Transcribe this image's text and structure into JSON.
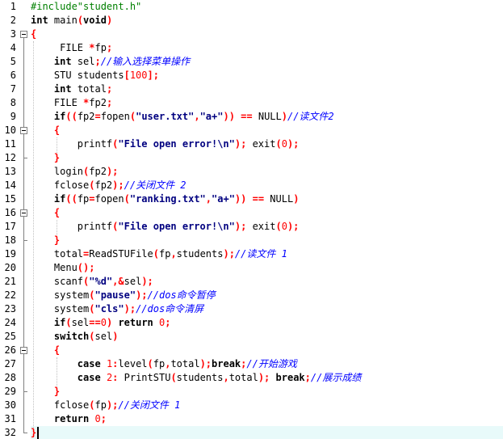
{
  "editor": {
    "current_line": 32,
    "lines": [
      {
        "n": "1",
        "tokens": [
          [
            "pp",
            "#include\"student.h\""
          ]
        ]
      },
      {
        "n": "2",
        "tokens": [
          [
            "kw",
            "int"
          ],
          [
            "pl",
            " main"
          ],
          [
            "op",
            "("
          ],
          [
            "kw",
            "void"
          ],
          [
            "op",
            ")"
          ]
        ]
      },
      {
        "n": "3",
        "tokens": [
          [
            "op",
            "{"
          ]
        ]
      },
      {
        "n": "4",
        "tokens": [
          [
            "pl",
            "     FILE "
          ],
          [
            "op",
            "*"
          ],
          [
            "pl",
            "fp"
          ],
          [
            "op",
            ";"
          ]
        ]
      },
      {
        "n": "5",
        "tokens": [
          [
            "pl",
            "    "
          ],
          [
            "kw",
            "int"
          ],
          [
            "pl",
            " sel"
          ],
          [
            "op",
            ";"
          ],
          [
            "cm",
            "//输入选择菜单操作"
          ]
        ]
      },
      {
        "n": "6",
        "tokens": [
          [
            "pl",
            "    STU students"
          ],
          [
            "op",
            "["
          ],
          [
            "num",
            "100"
          ],
          [
            "op",
            "];"
          ]
        ]
      },
      {
        "n": "7",
        "tokens": [
          [
            "pl",
            "    "
          ],
          [
            "kw",
            "int"
          ],
          [
            "pl",
            " total"
          ],
          [
            "op",
            ";"
          ]
        ]
      },
      {
        "n": "8",
        "tokens": [
          [
            "pl",
            "    FILE "
          ],
          [
            "op",
            "*"
          ],
          [
            "pl",
            "fp2"
          ],
          [
            "op",
            ";"
          ]
        ]
      },
      {
        "n": "9",
        "tokens": [
          [
            "pl",
            "    "
          ],
          [
            "kw",
            "if"
          ],
          [
            "op",
            "(("
          ],
          [
            "pl",
            "fp2"
          ],
          [
            "op",
            "="
          ],
          [
            "pl",
            "fopen"
          ],
          [
            "op",
            "("
          ],
          [
            "str",
            "\"user.txt\""
          ],
          [
            "op",
            ","
          ],
          [
            "str",
            "\"a+\""
          ],
          [
            "op",
            "))"
          ],
          [
            "pl",
            " "
          ],
          [
            "op",
            "=="
          ],
          [
            "pl",
            " NULL"
          ],
          [
            "op",
            ")"
          ],
          [
            "cm",
            "//读文件2"
          ]
        ]
      },
      {
        "n": "10",
        "tokens": [
          [
            "pl",
            "    "
          ],
          [
            "op",
            "{"
          ]
        ]
      },
      {
        "n": "11",
        "tokens": [
          [
            "pl",
            "        printf"
          ],
          [
            "op",
            "("
          ],
          [
            "str",
            "\"File open error!\\n\""
          ],
          [
            "op",
            ");"
          ],
          [
            "pl",
            " exit"
          ],
          [
            "op",
            "("
          ],
          [
            "num",
            "0"
          ],
          [
            "op",
            ");"
          ]
        ]
      },
      {
        "n": "12",
        "tokens": [
          [
            "pl",
            "    "
          ],
          [
            "op",
            "}"
          ]
        ]
      },
      {
        "n": "13",
        "tokens": [
          [
            "pl",
            "    login"
          ],
          [
            "op",
            "("
          ],
          [
            "pl",
            "fp2"
          ],
          [
            "op",
            ");"
          ]
        ]
      },
      {
        "n": "14",
        "tokens": [
          [
            "pl",
            "    fclose"
          ],
          [
            "op",
            "("
          ],
          [
            "pl",
            "fp2"
          ],
          [
            "op",
            ");"
          ],
          [
            "cm",
            "//关闭文件 2"
          ]
        ]
      },
      {
        "n": "15",
        "tokens": [
          [
            "pl",
            "    "
          ],
          [
            "kw",
            "if"
          ],
          [
            "op",
            "(("
          ],
          [
            "pl",
            "fp"
          ],
          [
            "op",
            "="
          ],
          [
            "pl",
            "fopen"
          ],
          [
            "op",
            "("
          ],
          [
            "str",
            "\"ranking.txt\""
          ],
          [
            "op",
            ","
          ],
          [
            "str",
            "\"a+\""
          ],
          [
            "op",
            "))"
          ],
          [
            "pl",
            " "
          ],
          [
            "op",
            "=="
          ],
          [
            "pl",
            " NULL"
          ],
          [
            "op",
            ")"
          ]
        ]
      },
      {
        "n": "16",
        "tokens": [
          [
            "pl",
            "    "
          ],
          [
            "op",
            "{"
          ]
        ]
      },
      {
        "n": "17",
        "tokens": [
          [
            "pl",
            "        printf"
          ],
          [
            "op",
            "("
          ],
          [
            "str",
            "\"File open error!\\n\""
          ],
          [
            "op",
            ");"
          ],
          [
            "pl",
            " exit"
          ],
          [
            "op",
            "("
          ],
          [
            "num",
            "0"
          ],
          [
            "op",
            ");"
          ]
        ]
      },
      {
        "n": "18",
        "tokens": [
          [
            "pl",
            "    "
          ],
          [
            "op",
            "}"
          ]
        ]
      },
      {
        "n": "19",
        "tokens": [
          [
            "pl",
            "    total"
          ],
          [
            "op",
            "="
          ],
          [
            "pl",
            "ReadSTUFile"
          ],
          [
            "op",
            "("
          ],
          [
            "pl",
            "fp"
          ],
          [
            "op",
            ","
          ],
          [
            "pl",
            "students"
          ],
          [
            "op",
            ");"
          ],
          [
            "cm",
            "//读文件 1"
          ]
        ]
      },
      {
        "n": "20",
        "tokens": [
          [
            "pl",
            "    Menu"
          ],
          [
            "op",
            "();"
          ]
        ]
      },
      {
        "n": "21",
        "tokens": [
          [
            "pl",
            "    scanf"
          ],
          [
            "op",
            "("
          ],
          [
            "str",
            "\"%d\""
          ],
          [
            "op",
            ",&"
          ],
          [
            "pl",
            "sel"
          ],
          [
            "op",
            ");"
          ]
        ]
      },
      {
        "n": "22",
        "tokens": [
          [
            "pl",
            "    system"
          ],
          [
            "op",
            "("
          ],
          [
            "str",
            "\"pause\""
          ],
          [
            "op",
            ");"
          ],
          [
            "cm",
            "//dos命令暂停"
          ]
        ]
      },
      {
        "n": "23",
        "tokens": [
          [
            "pl",
            "    system"
          ],
          [
            "op",
            "("
          ],
          [
            "str",
            "\"cls\""
          ],
          [
            "op",
            ");"
          ],
          [
            "cm",
            "//dos命令清屏"
          ]
        ]
      },
      {
        "n": "24",
        "tokens": [
          [
            "pl",
            "    "
          ],
          [
            "kw",
            "if"
          ],
          [
            "op",
            "("
          ],
          [
            "pl",
            "sel"
          ],
          [
            "op",
            "=="
          ],
          [
            "num",
            "0"
          ],
          [
            "op",
            ")"
          ],
          [
            "pl",
            " "
          ],
          [
            "kw",
            "return"
          ],
          [
            "pl",
            " "
          ],
          [
            "num",
            "0"
          ],
          [
            "op",
            ";"
          ]
        ]
      },
      {
        "n": "25",
        "tokens": [
          [
            "pl",
            "    "
          ],
          [
            "kw",
            "switch"
          ],
          [
            "op",
            "("
          ],
          [
            "pl",
            "sel"
          ],
          [
            "op",
            ")"
          ]
        ]
      },
      {
        "n": "26",
        "tokens": [
          [
            "pl",
            "    "
          ],
          [
            "op",
            "{"
          ]
        ]
      },
      {
        "n": "27",
        "tokens": [
          [
            "pl",
            "        "
          ],
          [
            "kw",
            "case"
          ],
          [
            "pl",
            " "
          ],
          [
            "num",
            "1"
          ],
          [
            "op",
            ":"
          ],
          [
            "pl",
            "level"
          ],
          [
            "op",
            "("
          ],
          [
            "pl",
            "fp"
          ],
          [
            "op",
            ","
          ],
          [
            "pl",
            "total"
          ],
          [
            "op",
            ");"
          ],
          [
            "kw",
            "break"
          ],
          [
            "op",
            ";"
          ],
          [
            "cm",
            "//开始游戏"
          ]
        ]
      },
      {
        "n": "28",
        "tokens": [
          [
            "pl",
            "        "
          ],
          [
            "kw",
            "case"
          ],
          [
            "pl",
            " "
          ],
          [
            "num",
            "2"
          ],
          [
            "op",
            ":"
          ],
          [
            "pl",
            " PrintSTU"
          ],
          [
            "op",
            "("
          ],
          [
            "pl",
            "students"
          ],
          [
            "op",
            ","
          ],
          [
            "pl",
            "total"
          ],
          [
            "op",
            ");"
          ],
          [
            "pl",
            " "
          ],
          [
            "kw",
            "break"
          ],
          [
            "op",
            ";"
          ],
          [
            "cm",
            "//展示成绩"
          ]
        ]
      },
      {
        "n": "29",
        "tokens": [
          [
            "pl",
            "    "
          ],
          [
            "op",
            "}"
          ]
        ]
      },
      {
        "n": "30",
        "tokens": [
          [
            "pl",
            "    fclose"
          ],
          [
            "op",
            "("
          ],
          [
            "pl",
            "fp"
          ],
          [
            "op",
            ");"
          ],
          [
            "cm",
            "//关闭文件 1"
          ]
        ]
      },
      {
        "n": "31",
        "tokens": [
          [
            "pl",
            "    "
          ],
          [
            "kw",
            "return"
          ],
          [
            "pl",
            " "
          ],
          [
            "num",
            "0"
          ],
          [
            "op",
            ";"
          ]
        ]
      },
      {
        "n": "32",
        "tokens": [
          [
            "op",
            "}"
          ]
        ]
      }
    ]
  },
  "folds": [
    {
      "start": 3,
      "end": 32
    },
    {
      "start": 10,
      "end": 12
    },
    {
      "start": 16,
      "end": 18
    },
    {
      "start": 26,
      "end": 29
    }
  ]
}
